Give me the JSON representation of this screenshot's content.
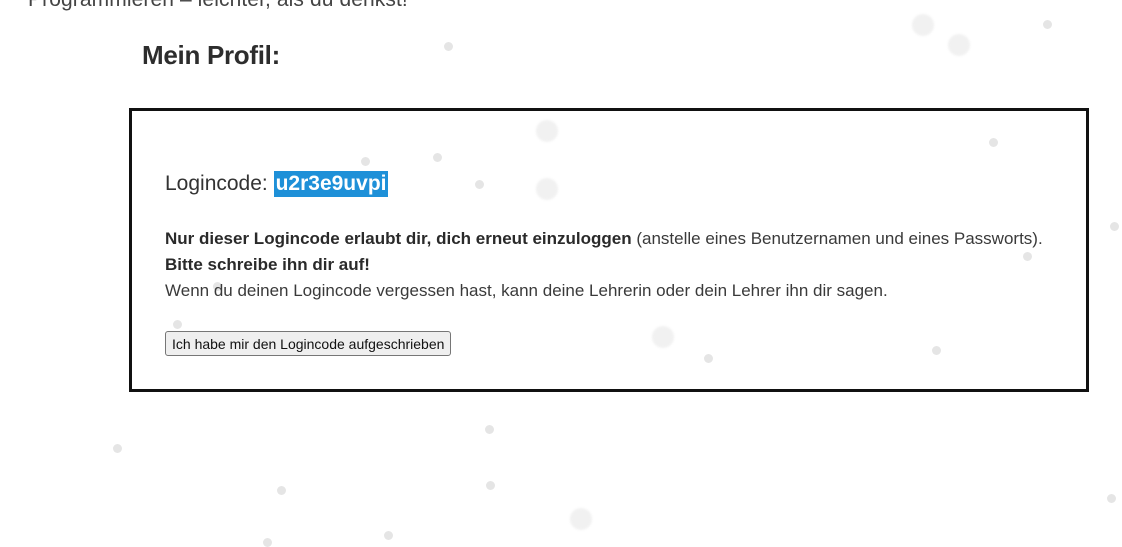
{
  "header": {
    "tagline": "Programmieren – leichter, als du denkst!"
  },
  "profile": {
    "title": "Mein Profil:",
    "login_label": "Logincode: ",
    "login_code": "u2r3e9uvpi",
    "info_bold_1": "Nur dieser Logincode erlaubt dir, dich erneut einzuloggen",
    "info_normal_1": " (anstelle eines Benutzernamen und eines Passworts).",
    "info_bold_2": "Bitte schreibe ihn dir auf!",
    "info_normal_2": "Wenn du deinen Logincode vergessen hast, kann deine Lehrerin oder dein Lehrer ihn dir sagen.",
    "confirm_button_label": "Ich habe mir den Logincode aufgeschrieben"
  },
  "colors": {
    "highlight": "#1e90d8",
    "border": "#111111",
    "background": "#ffffff"
  }
}
